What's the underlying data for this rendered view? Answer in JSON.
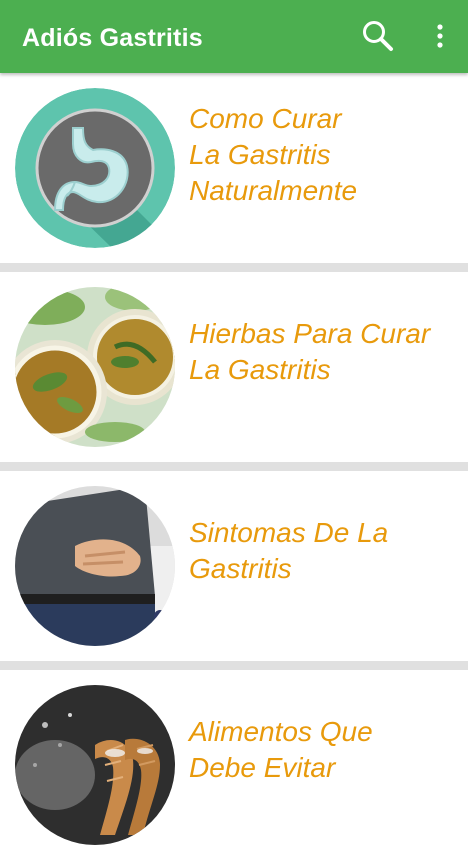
{
  "app": {
    "title": "Adiós Gastritis"
  },
  "colors": {
    "appbar": "#4caf50",
    "title_text": "#e89a0c",
    "separator": "#e0e0e0"
  },
  "icons": {
    "search": "search-icon",
    "overflow_menu": "more-vert-icon"
  },
  "items": [
    {
      "title": "Como Curar\nLa Gastritis\nNaturalmente",
      "image": "stomach-icon"
    },
    {
      "title": "Hierbas Para Curar\nLa Gastritis",
      "image": "herbal-tea-photo"
    },
    {
      "title": "Sintomas De La\nGastritis",
      "image": "stomach-pain-photo"
    },
    {
      "title": "Alimentos Que\nDebe Evitar",
      "image": "churros-photo"
    }
  ]
}
